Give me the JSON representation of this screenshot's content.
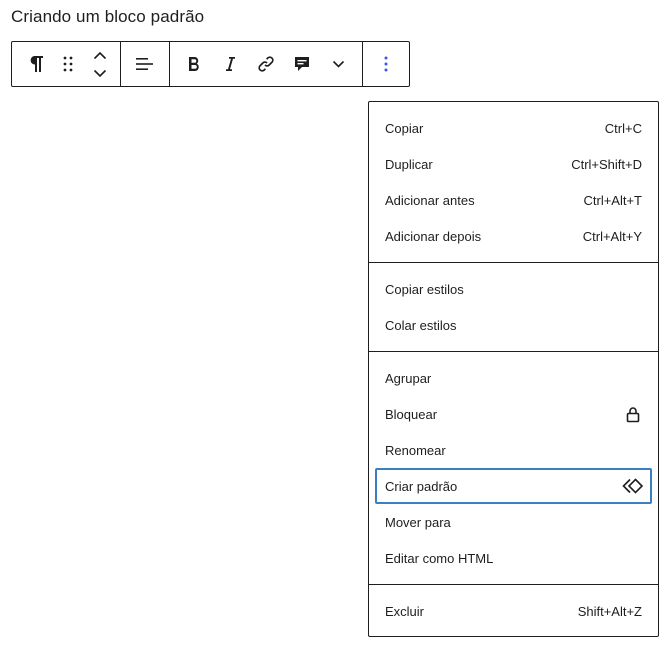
{
  "page": {
    "title": "Criando um bloco padrão"
  },
  "toolbar": {
    "groups": [
      [
        "paragraph-icon",
        "drag-handle-icon",
        "move-up-icon",
        "move-down-icon"
      ],
      [
        "align-left-icon"
      ],
      [
        "bold-icon",
        "italic-icon",
        "link-icon",
        "comment-icon",
        "chevron-down-icon"
      ],
      [
        "more-vertical-icon"
      ]
    ]
  },
  "menu": {
    "sections": [
      {
        "items": [
          {
            "label": "Copiar",
            "shortcut": "Ctrl+C"
          },
          {
            "label": "Duplicar",
            "shortcut": "Ctrl+Shift+D"
          },
          {
            "label": "Adicionar antes",
            "shortcut": "Ctrl+Alt+T"
          },
          {
            "label": "Adicionar depois",
            "shortcut": "Ctrl+Alt+Y"
          }
        ]
      },
      {
        "items": [
          {
            "label": "Copiar estilos"
          },
          {
            "label": "Colar estilos"
          }
        ]
      },
      {
        "items": [
          {
            "label": "Agrupar"
          },
          {
            "label": "Bloquear",
            "icon": "lock-icon"
          },
          {
            "label": "Renomear"
          },
          {
            "label": "Criar padrão",
            "icon": "pattern-diamond-icon",
            "focused": true
          },
          {
            "label": "Mover para"
          },
          {
            "label": "Editar como HTML"
          }
        ]
      },
      {
        "items": [
          {
            "label": "Excluir",
            "shortcut": "Shift+Alt+Z"
          }
        ]
      }
    ]
  },
  "colors": {
    "text": "#1e1e1e",
    "border": "#1e1e1e",
    "focus": "#3a7fc1",
    "options_icon": "#3858e9"
  }
}
